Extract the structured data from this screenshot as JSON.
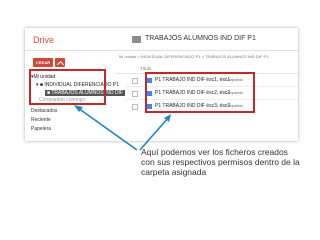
{
  "app": {
    "name": "Drive"
  },
  "header": {
    "folder_title": "TRABAJOS ALUMNOS IND DIF P1"
  },
  "toolbar": {
    "create_label": "CREAR"
  },
  "breadcrumb": "Mi unidad  >  INDIVIDUAL DIFERENCIADO P1  >  TRABAJOS ALUMNOS IND DIF P1",
  "list_header": {
    "title_col": "Título"
  },
  "sidebar": {
    "tree": {
      "root": "Mi unidad",
      "child": "INDIVIDUAL DIFERENCIADO P1",
      "grandchild": "TRABAJOS ALUMNOS IND DIF"
    },
    "partial_item": "Compartido conmigo",
    "items": [
      "Destacados",
      "Reciente",
      "Papelera"
    ]
  },
  "files": [
    {
      "name": "P1 TRABAJO IND DIF ésc1, ésc1",
      "badge": "Compartido"
    },
    {
      "name": "P1 TRABAJO IND DIF ésc2, ésc2",
      "badge": "Compartido"
    },
    {
      "name": "P1 TRABAJO IND DIF ésc3, ésc3",
      "badge": "Compartido"
    }
  ],
  "caption": "Aquí podemos ver los ficheros creados con sus respectivos permisos dentro de la carpeta asignada",
  "colors": {
    "accent": "#dd4b39",
    "highlight_border": "#c62828",
    "arrow": "#1e88c7"
  }
}
